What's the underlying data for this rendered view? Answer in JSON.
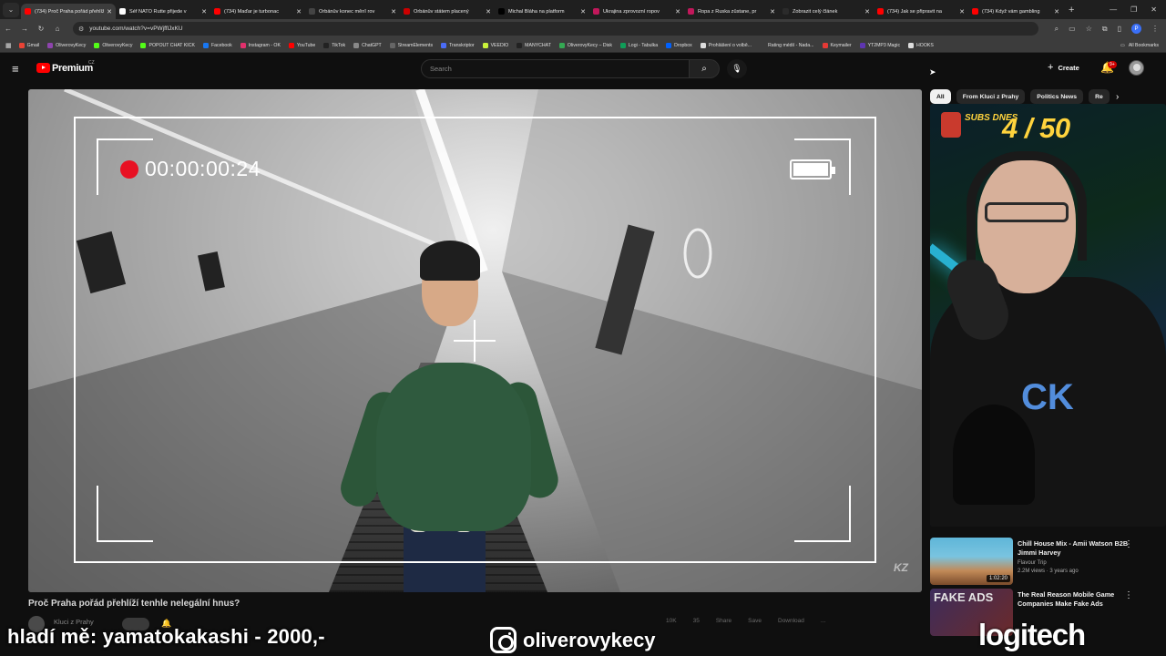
{
  "browser": {
    "tabs": [
      {
        "title": "(734) Proč Praha pořád přehlíží",
        "active": true,
        "favicon_color": "#ff0000"
      },
      {
        "title": "Šéf NATO Rutte přijede v",
        "active": false,
        "favicon_color": "#ffffff"
      },
      {
        "title": "(734) Maďar je turbonac",
        "active": false,
        "favicon_color": "#ff0000"
      },
      {
        "title": "Orbánův konec měnî rov",
        "active": false,
        "favicon_color": "#444444"
      },
      {
        "title": "Orbánův státem placený",
        "active": false,
        "favicon_color": "#cc0000"
      },
      {
        "title": "Michal Bláha na platform",
        "active": false,
        "favicon_color": "#000000"
      },
      {
        "title": "Ukrajina zprovozní ropov",
        "active": false,
        "favicon_color": "#c2185b"
      },
      {
        "title": "Ropa z Ruska zůstane, pr",
        "active": false,
        "favicon_color": "#c2185b"
      },
      {
        "title": "Zobrazit celý článek",
        "active": false,
        "favicon_color": "#2b2b2b"
      },
      {
        "title": "(734) Jak se připravit na",
        "active": false,
        "favicon_color": "#ff0000"
      },
      {
        "title": "(734) Když vám gambling",
        "active": false,
        "favicon_color": "#ff0000"
      }
    ],
    "url": "youtube.com/watch?v=vPWjfflJxKU",
    "bookmarks": [
      {
        "label": "Gmail",
        "color": "#ea4335"
      },
      {
        "label": "OliverovyKecy",
        "color": "#8e44ad"
      },
      {
        "label": "OliverovyKecy",
        "color": "#53fc18"
      },
      {
        "label": "POPOUT CHAT KICK",
        "color": "#53fc18"
      },
      {
        "label": "Facebook",
        "color": "#1877f2"
      },
      {
        "label": "Instagram - OK",
        "color": "#e1306c"
      },
      {
        "label": "YouTube",
        "color": "#ff0000"
      },
      {
        "label": "TikTok",
        "color": "#222222"
      },
      {
        "label": "ChatGPT",
        "color": "#888888"
      },
      {
        "label": "StreamElements",
        "color": "#666666"
      },
      {
        "label": "Transkriptor",
        "color": "#4a6cf7"
      },
      {
        "label": "VEEDIO",
        "color": "#c9f23a"
      },
      {
        "label": "MANYCHAT",
        "color": "#222222"
      },
      {
        "label": "OliverovyKecy – Disk",
        "color": "#34a853"
      },
      {
        "label": "Logi - Tabulka",
        "color": "#0f9d58"
      },
      {
        "label": "Dropbox",
        "color": "#0061fe"
      },
      {
        "label": "Prohlášení o volbě...",
        "color": "#dddddd"
      },
      {
        "label": "Rating médií - Nada...",
        "color": "#3c3c3c"
      },
      {
        "label": "Keymailer",
        "color": "#e53935"
      },
      {
        "label": "YT2MP3 Magic",
        "color": "#5e35b1"
      },
      {
        "label": "HOOKS",
        "color": "#dddddd"
      }
    ],
    "all_bookmarks_label": "All Bookmarks"
  },
  "header": {
    "premium_label": "Premium",
    "country": "CZ",
    "search_placeholder": "Search",
    "create_label": "Create",
    "notifications_badge": "9+"
  },
  "player": {
    "rec_timecode": "00:00:00:24",
    "watermark": "KZ"
  },
  "video": {
    "title": "Proč Praha pořád přehlíží tenhle nelegální hnus?",
    "channel": "Kluci z Prahy",
    "actions": [
      "10K",
      "35",
      "Share",
      "Save",
      "Download",
      "..."
    ]
  },
  "sidebar": {
    "chips": [
      "All",
      "From Kluci z Prahy",
      "Politics News",
      "Re"
    ],
    "webcam_overlay": {
      "label": "SUBS DNES",
      "count": "4 / 50",
      "shirt_text": "CK"
    },
    "recommended": [
      {
        "title": "Chill House Mix - Amii Watson B2B Jimmi Harvey",
        "channel": "Flavour Trip",
        "meta": "2.2M views · 3 years ago",
        "duration": "1:02:20"
      },
      {
        "title": "The Real Reason Mobile Game Companies Make Fake Ads",
        "channel": "",
        "meta": "",
        "duration": "",
        "thumb_text": "FAKE ADS"
      }
    ]
  },
  "stream_overlay": {
    "donate_text": "hladí mě: yamatokakashi - 2000,-",
    "instagram_handle": "oliverovykecy",
    "sponsor": "logitech"
  }
}
